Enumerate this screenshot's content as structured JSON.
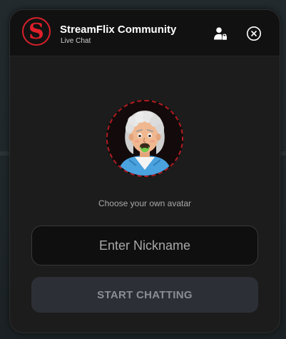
{
  "header": {
    "title": "StreamFlix Community",
    "subtitle": "Live Chat",
    "logo_letter": "S",
    "profile_icon": "user-lock-icon",
    "close_icon": "close-circle-icon"
  },
  "avatar": {
    "caption": "Choose your own avatar",
    "icon": "grandma-avatar"
  },
  "nickname": {
    "value": "",
    "placeholder": "Enter Nickname"
  },
  "start_button": {
    "label": "START CHATTING"
  },
  "colors": {
    "brand_red": "#e01f2a",
    "panel_bg": "#1c1c1c",
    "header_bg": "#111111",
    "button_bg": "#2c3036"
  }
}
